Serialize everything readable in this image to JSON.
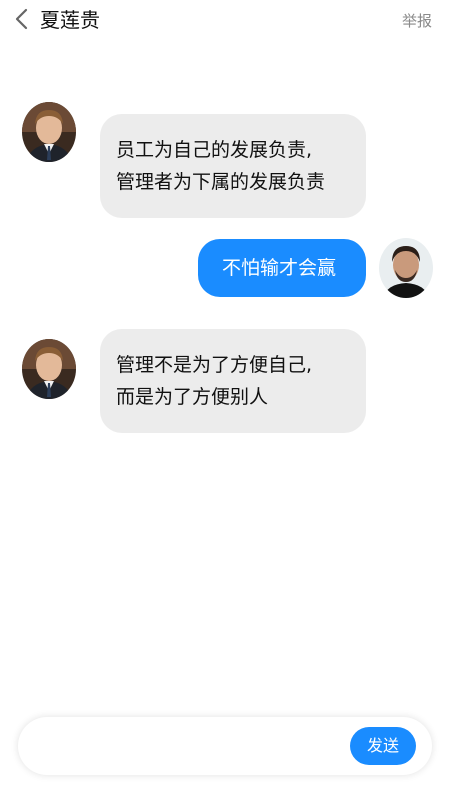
{
  "header": {
    "back_icon": "chevron-left-icon",
    "title": "夏莲贵",
    "report_label": "举报"
  },
  "messages": [
    {
      "direction": "incoming",
      "avatar": "contact-avatar",
      "lines": [
        "员工为自己的发展负责,",
        "管理者为下属的发展负责"
      ]
    },
    {
      "direction": "outgoing",
      "avatar": "user-avatar",
      "lines": [
        "不怕输才会赢"
      ]
    },
    {
      "direction": "incoming",
      "avatar": "contact-avatar",
      "lines": [
        "管理不是为了方便自己,",
        "而是为了方便别人"
      ]
    }
  ],
  "composer": {
    "input_value": "",
    "send_label": "发送"
  },
  "colors": {
    "accent": "#1a8cff",
    "incoming_bubble": "#ececec",
    "report_text": "#8a8a8a"
  }
}
